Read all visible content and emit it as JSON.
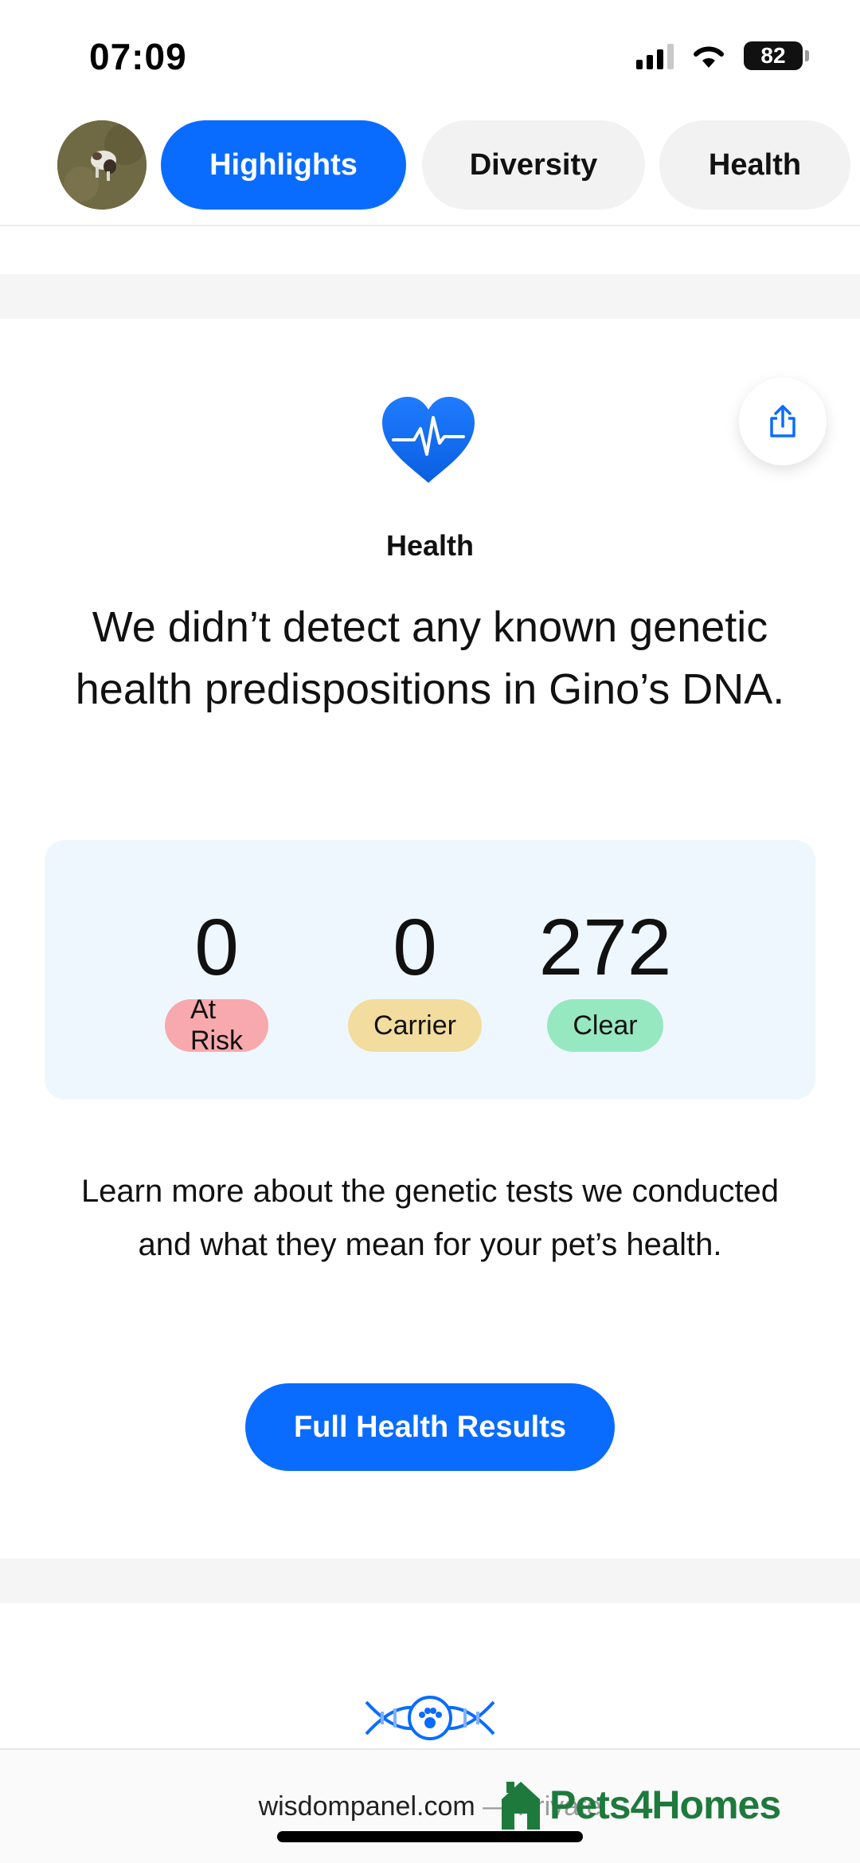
{
  "status_bar": {
    "time": "07:09",
    "battery": "82",
    "icons": [
      "cellular-signal-icon",
      "wifi-icon",
      "battery-icon"
    ]
  },
  "tabs": {
    "avatar": "pet-avatar",
    "items": [
      {
        "label": "Highlights",
        "active": true
      },
      {
        "label": "Diversity",
        "active": false
      },
      {
        "label": "Health",
        "active": false
      }
    ]
  },
  "health": {
    "icon": "heart-pulse-icon",
    "share_icon": "share-icon",
    "label": "Health",
    "headline": "We didn’t detect any known genetic health predispositions in Gino’s DNA."
  },
  "stats": [
    {
      "value": "0",
      "label": "At Risk",
      "color": "#f7a9ad"
    },
    {
      "value": "0",
      "label": "Carrier",
      "color": "#f2dc9e"
    },
    {
      "value": "272",
      "label": "Clear",
      "color": "#96e8c0"
    }
  ],
  "learn_more": "Learn more about the genetic tests we conducted and what they mean for your pet’s health.",
  "cta_label": "Full Health Results",
  "browser": {
    "url": "wisdompanel.com",
    "url_suffix": " — Private"
  },
  "watermark": "Pets4Homes",
  "colors": {
    "accent": "#0a6cff",
    "card_bg": "#eef7fd"
  }
}
